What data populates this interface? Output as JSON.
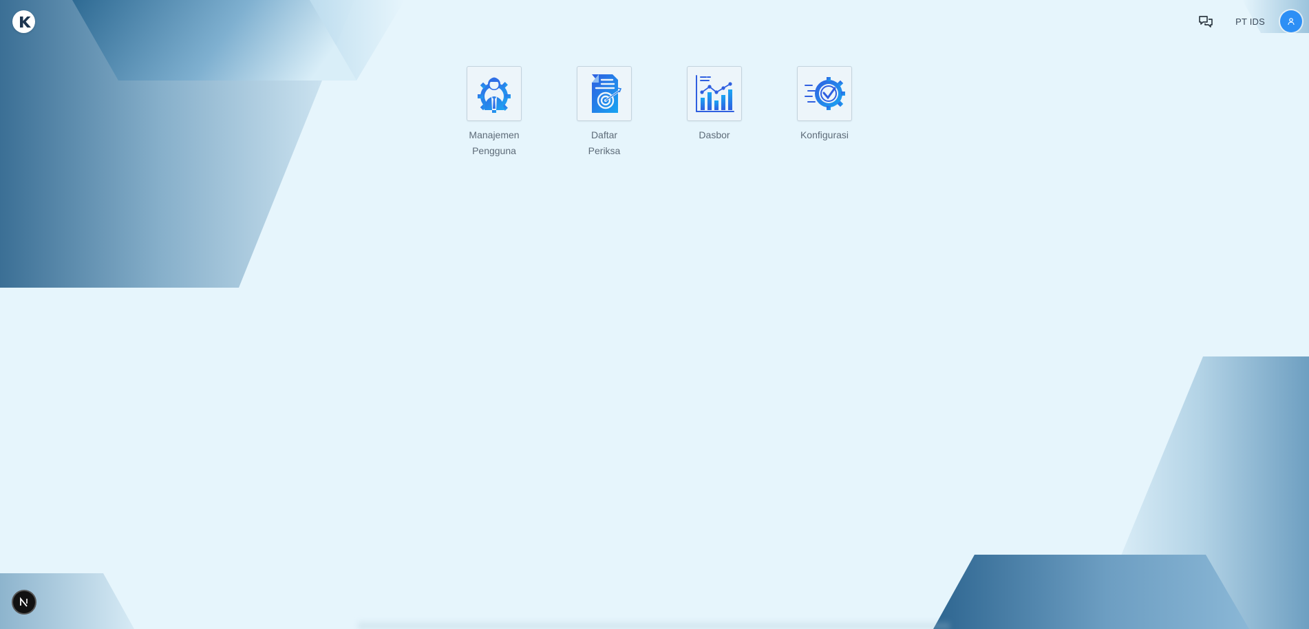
{
  "header": {
    "company": "PT IDS",
    "logo_icon": "k-logo-icon",
    "chat_icon": "chat-bubbles-icon",
    "avatar_icon": "user-icon"
  },
  "apps": [
    {
      "label_line1": "Manajemen",
      "label_line2": "Pengguna",
      "icon": "user-gear-icon"
    },
    {
      "label_line1": "Daftar",
      "label_line2": "Periksa",
      "icon": "document-target-icon"
    },
    {
      "label_line1": "Dasbor",
      "label_line2": "",
      "icon": "bar-chart-icon"
    },
    {
      "label_line1": "Konfigurasi",
      "label_line2": "",
      "icon": "gear-check-icon"
    }
  ],
  "footer": {
    "badge_icon": "n-logo-icon"
  },
  "colors": {
    "background": "#e6f5fc",
    "accent_blue": "#2d8ff5",
    "shape_dark": "#2f6a94",
    "label_text": "#5d6b78"
  }
}
